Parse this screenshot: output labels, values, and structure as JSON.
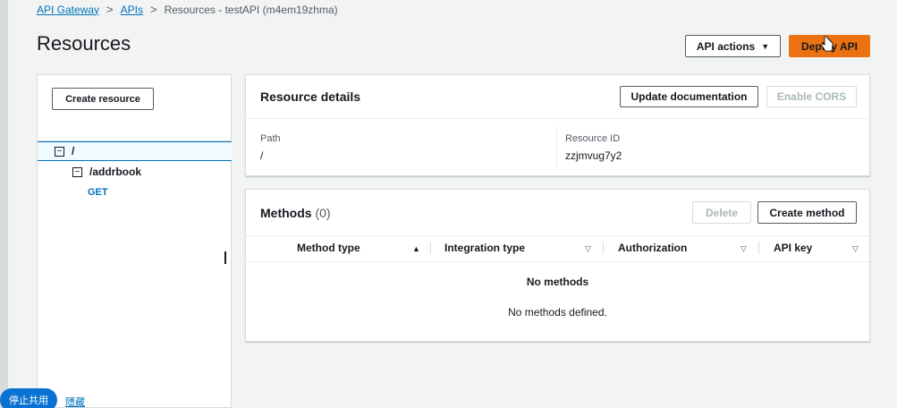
{
  "breadcrumb": {
    "items": [
      {
        "label": "API Gateway",
        "link": true
      },
      {
        "label": "APIs",
        "link": true
      },
      {
        "label": "Resources - testAPI (m4em19zhma)",
        "link": false
      }
    ],
    "separator": ">"
  },
  "page": {
    "title": "Resources"
  },
  "header_actions": {
    "api_actions_label": "API actions",
    "deploy_label": "Deploy API"
  },
  "tree": {
    "create_resource_label": "Create resource",
    "root_path": "/",
    "child_path": "/addrbook",
    "method": "GET"
  },
  "resource_details": {
    "title": "Resource details",
    "update_doc_label": "Update documentation",
    "enable_cors_label": "Enable CORS",
    "path_label": "Path",
    "path_value": "/",
    "resource_id_label": "Resource ID",
    "resource_id_value": "zzjmvug7y2"
  },
  "methods": {
    "title": "Methods",
    "count": "(0)",
    "delete_label": "Delete",
    "create_label": "Create method",
    "columns": [
      "Method type",
      "Integration type",
      "Authorization",
      "API key"
    ],
    "empty_title": "No methods",
    "empty_desc": "No methods defined."
  },
  "overlay": {
    "stop_share_label": "停止共用",
    "hide_label": "隱藏"
  },
  "colors": {
    "link": "#0073bb",
    "primary": "#ec7211",
    "background": "#f2f3f3"
  }
}
